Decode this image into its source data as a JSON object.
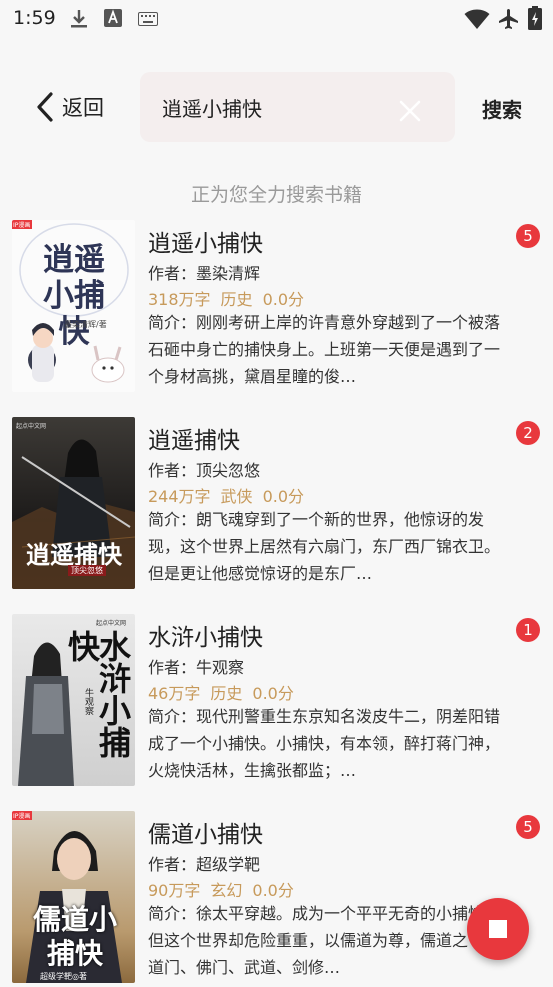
{
  "status_bar": {
    "time": "1:59"
  },
  "header": {
    "back_label": "返回",
    "search_value": "逍遥小捕快",
    "search_button": "搜索"
  },
  "progress_text": "正为您全力搜索书籍",
  "results": [
    {
      "title": "逍遥小捕快",
      "author": "作者：墨染清辉",
      "words": "318万字",
      "genre": "历史",
      "score": "0.0分",
      "intro": "简介：刚刚考研上岸的许青意外穿越到了一个被落石砸中身亡的捕快身上。上班第一天便是遇到了一个身材高挑，黛眉星瞳的俊…",
      "badge": "5",
      "cover_text": "逍遥小捕快",
      "cover_author": "墨染清辉/著",
      "cover_tag": "IP漫画"
    },
    {
      "title": "逍遥捕快",
      "author": "作者：顶尖忽悠",
      "words": "244万字",
      "genre": "武侠",
      "score": "0.0分",
      "intro": "简介：朗飞魂穿到了一个新的世界，他惊讶的发现，这个世界上居然有六扇门，东厂西厂锦衣卫。但是更让他感觉惊讶的是东厂…",
      "badge": "2",
      "cover_text": "逍遥捕快",
      "cover_author": "顶尖忽悠",
      "cover_tag": "起点中文网"
    },
    {
      "title": "水浒小捕快",
      "author": "作者：牛观察",
      "words": "46万字",
      "genre": "历史",
      "score": "0.0分",
      "intro": "简介：现代刑警重生东京知名泼皮牛二，阴差阳错成了一个小捕快。小捕快，有本领，醉打蒋门神，火烧快活林，生擒张都监；…",
      "badge": "1",
      "cover_text": "水浒小捕快",
      "cover_author": "牛观察",
      "cover_tag": "起点中文网"
    },
    {
      "title": "儒道小捕快",
      "author": "作者：超级学靶",
      "words": "90万字",
      "genre": "玄幻",
      "score": "0.0分",
      "intro": "简介：徐太平穿越。成为一个平平无奇的小捕快。但这个世界却危险重重，以儒道为尊，儒道之下有道门、佛门、武道、剑修…",
      "badge": "5",
      "cover_text": "儒道小捕快",
      "cover_author": "超级学靶◎著",
      "cover_tag": "IP漫画"
    }
  ],
  "colors": {
    "accent": "#e8383d",
    "meta": "#c79a5b",
    "background": "#f7f7f7",
    "search_bg": "#f4eeee"
  },
  "icons": [
    "download-icon",
    "a-icon",
    "keyboard-icon",
    "wifi-icon",
    "airplane-icon",
    "battery-icon",
    "back-chevron-icon",
    "clear-icon",
    "stop-icon"
  ]
}
